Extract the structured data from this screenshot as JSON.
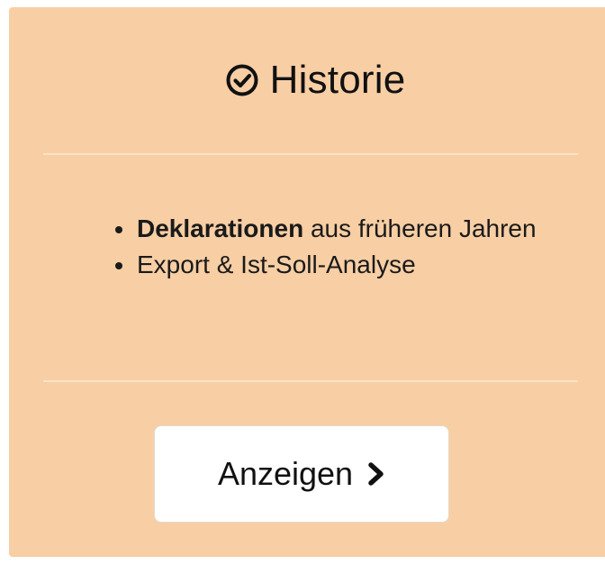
{
  "card": {
    "title": "Historie",
    "title_icon": "check-circle-icon",
    "features": [
      {
        "bold": "Deklarationen",
        "text": " aus früheren Jahren"
      },
      {
        "bold": "",
        "text": "Export & Ist-Soll-Analyse"
      }
    ],
    "button_label": "Anzeigen",
    "button_icon": "chevron-right-icon"
  },
  "colors": {
    "card_bg": "#f8cea4",
    "divider": "#fbe2c8",
    "button_bg": "#ffffff",
    "text": "#111111"
  }
}
